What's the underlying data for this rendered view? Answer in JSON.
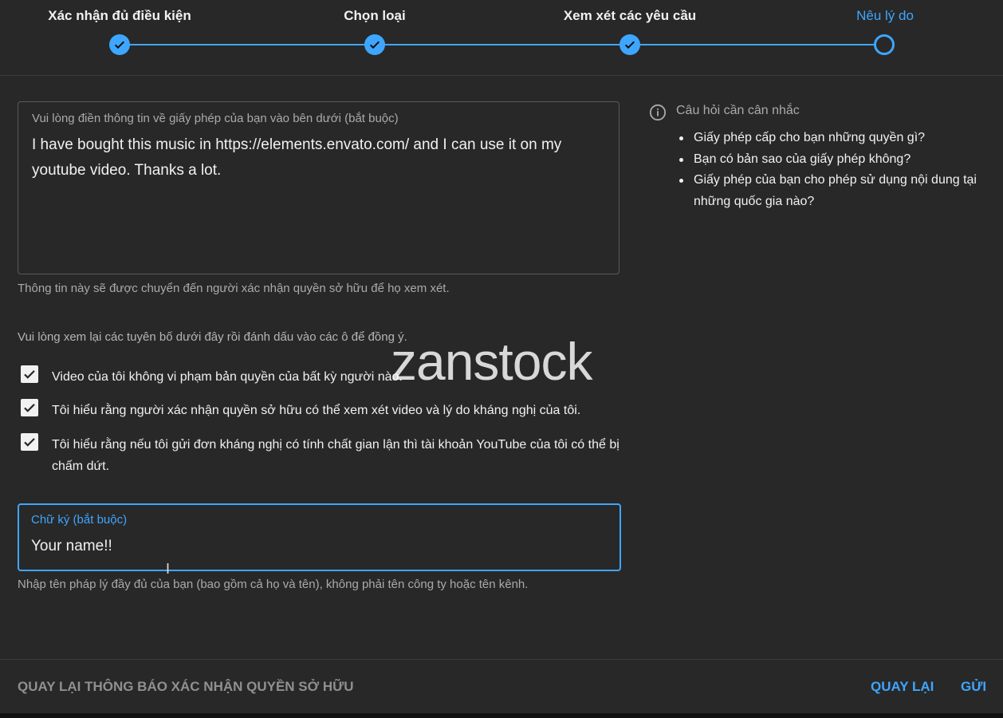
{
  "stepper": {
    "steps": [
      {
        "label": "Xác nhận đủ điều kiện",
        "state": "done"
      },
      {
        "label": "Chọn loại",
        "state": "done"
      },
      {
        "label": "Xem xét các yêu cầu",
        "state": "done"
      },
      {
        "label": "Nêu lý do",
        "state": "current"
      }
    ]
  },
  "reason": {
    "label": "Vui lòng điền thông tin về giấy phép của bạn vào bên dưới (bắt buộc)",
    "value": "I have bought this music in https://elements.envato.com/ and I can use it on my youtube video. Thanks a lot.",
    "helper": "Thông tin này sẽ được chuyển đến người xác nhận quyền sở hữu để họ xem xét."
  },
  "statements": {
    "intro": "Vui lòng xem lại các tuyên bố dưới đây rồi đánh dấu vào các ô để đồng ý.",
    "items": [
      {
        "text": "Video của tôi không vi phạm bản quyền của bất kỳ người nào.",
        "checked": true
      },
      {
        "text": "Tôi hiểu rằng người xác nhận quyền sở hữu có thể xem xét video và lý do kháng nghị của tôi.",
        "checked": true
      },
      {
        "text": "Tôi hiểu rằng nếu tôi gửi đơn kháng nghị có tính chất gian lận thì tài khoản YouTube của tôi có thể bị chấm dứt.",
        "checked": true
      }
    ]
  },
  "signature": {
    "label": "Chữ ký (bắt buộc)",
    "value": "Your name!!",
    "helper": "Nhập tên pháp lý đầy đủ của bạn (bao gồm cả họ và tên), không phải tên công ty hoặc tên kênh."
  },
  "info_panel": {
    "icon": "info-icon",
    "title": "Câu hỏi cần cân nhắc",
    "questions": [
      "Giấy phép cấp cho bạn những quyền gì?",
      "Bạn có bản sao của giấy phép không?",
      "Giấy phép của bạn cho phép sử dụng nội dung tại những quốc gia nào?"
    ]
  },
  "watermark": "zanstock",
  "footer": {
    "back_to_claim": "QUAY LẠI THÔNG BÁO XÁC NHẬN QUYỀN SỞ HỮU",
    "back": "QUAY LẠI",
    "submit": "GỬI"
  },
  "colors": {
    "background": "#282828",
    "accent": "#3ea6ff",
    "muted_text": "#aaaaaa"
  }
}
